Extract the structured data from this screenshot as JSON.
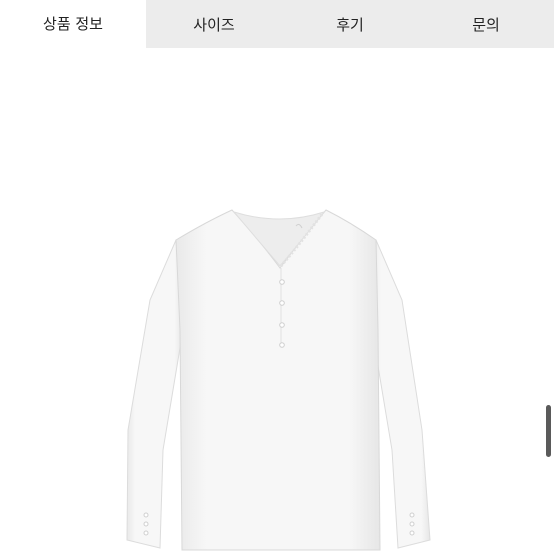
{
  "tabs": {
    "product_info": "상품 정보",
    "size": "사이즈",
    "reviews": "후기",
    "inquiry": "문의"
  },
  "colors": {
    "tab_bar_bg": "#ececec",
    "active_tab_bg": "#ffffff",
    "garment": "#f6f6f6"
  },
  "product_image": {
    "icon": "long-sleeve-henley-top-image"
  }
}
